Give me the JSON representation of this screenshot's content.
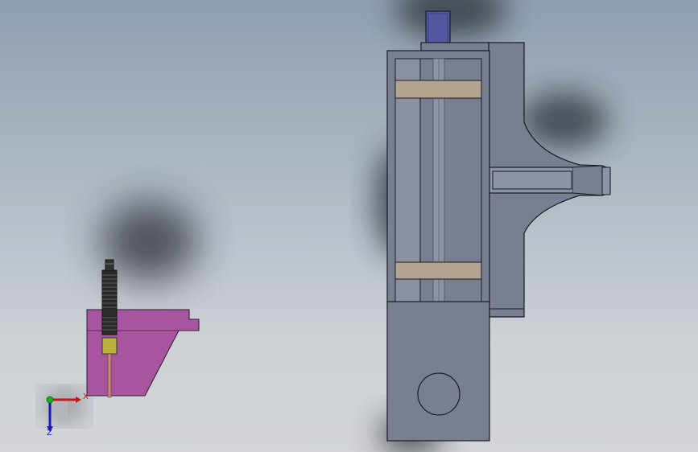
{
  "scene": {
    "view": "front",
    "background_top": "#8f9fb0",
    "background_bottom": "#d3d5d8",
    "colors": {
      "steel": "#787f91",
      "steel_dark": "#6b7284",
      "rod": "#8b93a4",
      "edge": "#1a1c22",
      "guide_block": "#b3a48f",
      "top_cap": "#5257a0",
      "bracket": "#a855a0",
      "sensor_body": "#2a2a2a",
      "sensor_tip": "#b8b23c",
      "probe": "#c28b7a",
      "axis_x": "#c01818",
      "axis_y": "#18b018",
      "axis_z": "#1818c0"
    }
  },
  "triad": {
    "x_label": "X",
    "z_label": "Z",
    "x_color": "#c01818",
    "y_color": "#18b018",
    "z_color": "#1818c0"
  }
}
